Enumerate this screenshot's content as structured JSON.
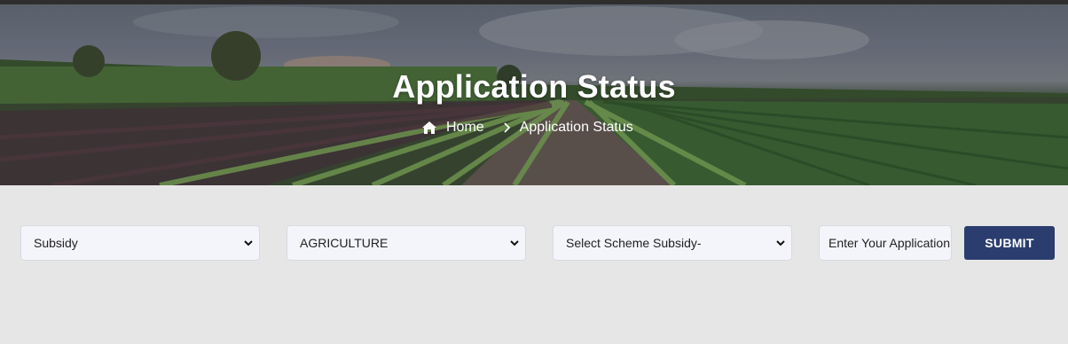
{
  "header": {
    "title": "Application Status",
    "breadcrumb": {
      "home_label": "Home",
      "current_label": "Application Status"
    }
  },
  "form": {
    "category_select": {
      "selected": "Subsidy"
    },
    "department_select": {
      "selected": "AGRICULTURE"
    },
    "scheme_select": {
      "selected": "Select Scheme Subsidy-"
    },
    "application_input": {
      "placeholder": "Enter Your Application No"
    },
    "submit_label": "SUBMIT"
  },
  "icons": {
    "home": "home-icon",
    "breadcrumb_separator": "chevron-right-icon",
    "dropdown": "chevron-down-icon"
  },
  "colors": {
    "submit_bg": "#2b3d6e",
    "field_bg": "#f4f5fa",
    "page_bg": "#e6e6e6"
  }
}
